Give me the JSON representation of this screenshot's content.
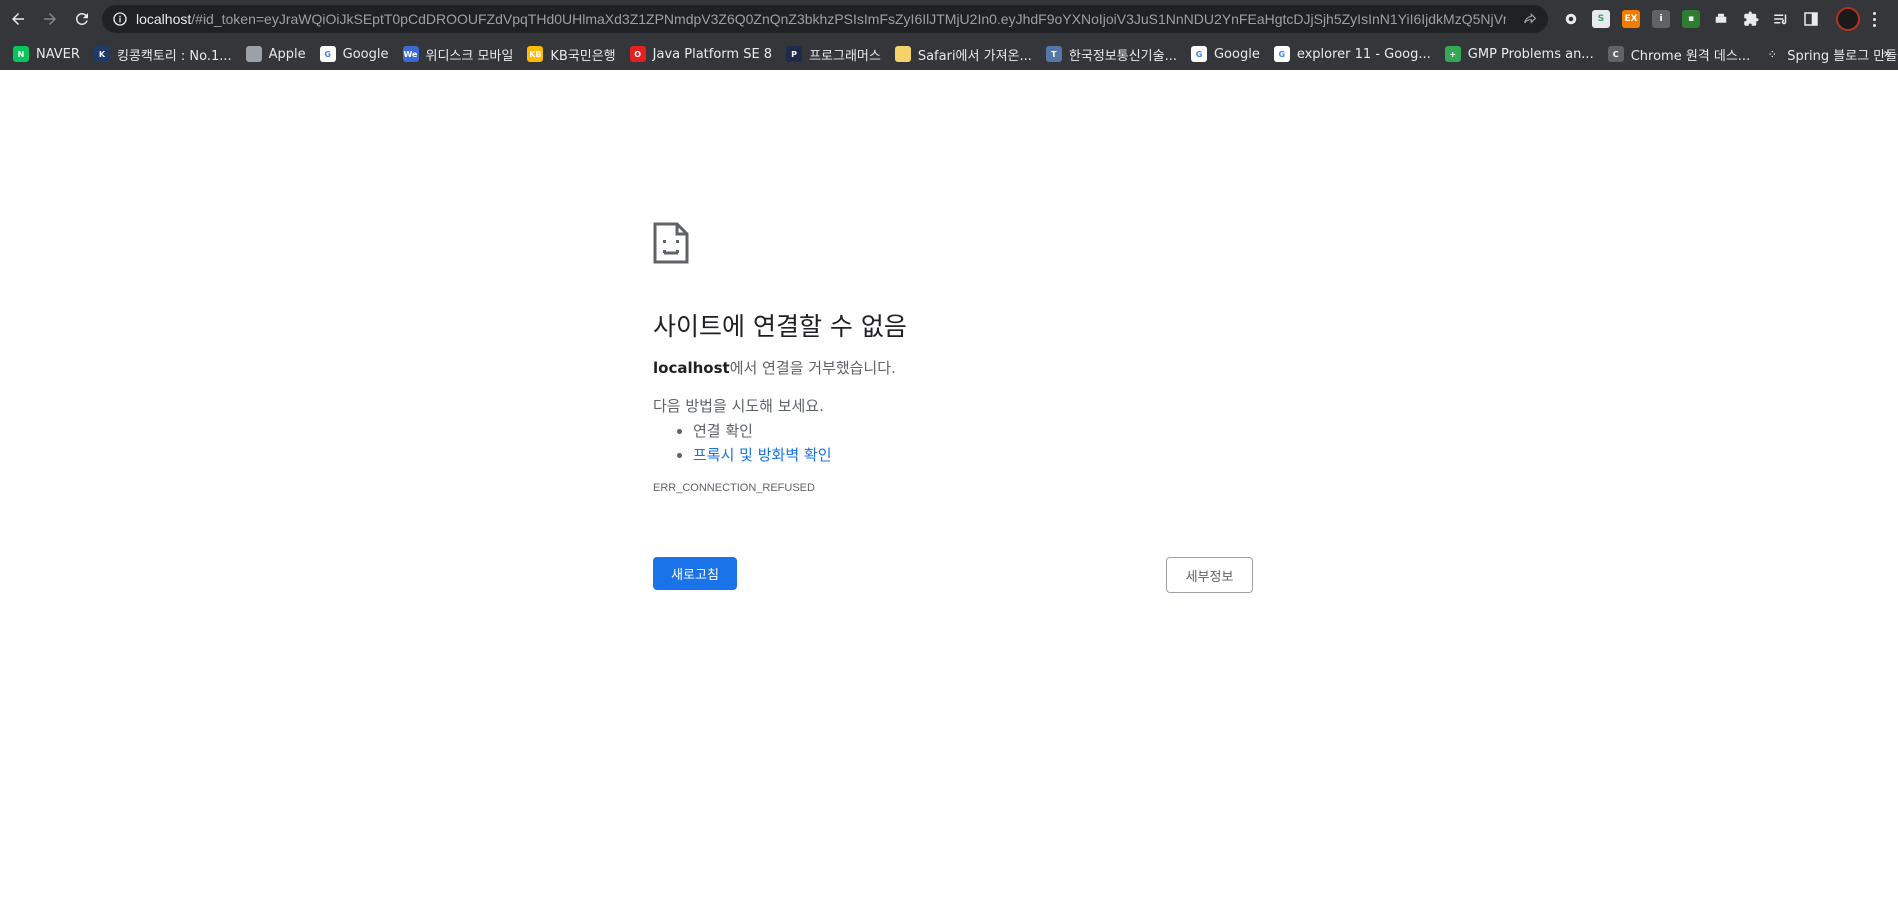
{
  "browser": {
    "url_host": "localhost",
    "url_rest": "/#id_token=eyJraWQiOiJkSEptT0pCdDROOUFZdVpqTHd0UHlmaXd3Z1ZPNmdpV3Z6Q0ZnQnZ3bkhzPSIsImFsZyI6IlJTMjU2In0.eyJhdF9oYXNoIjoiV3JuS1NnNDU2YnFEaHgtcDJjSjh5ZyIsInN1YiI6IjdkMzQ5NjVmL...",
    "extensions": [
      "settings-gear-ext",
      "spreadsheet-ext",
      "ex-ext",
      "info-ext",
      "green-ext",
      "printer-ext",
      "puzzle-extensions",
      "reading-list",
      "side-panel"
    ],
    "colors": {
      "toolbar": "#35363a",
      "omnibox": "#202124"
    }
  },
  "bookmarks": [
    {
      "label": "NAVER",
      "icon": "naver-icon",
      "color": "#03c75a",
      "glyph": "N"
    },
    {
      "label": "킹콩캑토리 : No.1...",
      "icon": "kingkong-icon",
      "color": "#1f3b6b",
      "glyph": "K"
    },
    {
      "label": "Apple",
      "icon": "apple-icon",
      "color": "#9aa0a6",
      "glyph": ""
    },
    {
      "label": "Google",
      "icon": "google-icon",
      "color": "#ffffff",
      "glyph": "G"
    },
    {
      "label": "위디스크 모바일",
      "icon": "wedisk-icon",
      "color": "#3b6ad6",
      "glyph": "We"
    },
    {
      "label": "KB국민은행",
      "icon": "kb-icon",
      "color": "#ffbc00",
      "glyph": "KB"
    },
    {
      "label": "Java Platform SE 8",
      "icon": "oracle-icon",
      "color": "#e52020",
      "glyph": "O"
    },
    {
      "label": "프로그래머스",
      "icon": "programmers-icon",
      "color": "#1e2a4a",
      "glyph": "P"
    },
    {
      "label": "Safari에서 가져온...",
      "icon": "folder-icon",
      "color": "#f6d26b",
      "glyph": ""
    },
    {
      "label": "한국정보통신기술...",
      "icon": "tta-icon",
      "color": "#5577aa",
      "glyph": "T"
    },
    {
      "label": "Google",
      "icon": "google-icon",
      "color": "#ffffff",
      "glyph": "G"
    },
    {
      "label": "explorer 11 - Goog...",
      "icon": "google-icon",
      "color": "#ffffff",
      "glyph": "G"
    },
    {
      "label": "GMP Problems an...",
      "icon": "gmp-icon",
      "color": "#34a853",
      "glyph": "+"
    },
    {
      "label": "Chrome 원격 데스...",
      "icon": "remote-desktop-icon",
      "color": "#5f6368",
      "glyph": "C"
    },
    {
      "label": "Spring 블로그 만들...",
      "icon": "spring-icon",
      "color": "#35363a",
      "glyph": "⁘"
    }
  ],
  "error_page": {
    "title": "사이트에 연결할 수 없음",
    "host": "localhost",
    "desc_suffix": "에서 연결을 거부했습니다.",
    "try_title": "다음 방법을 시도해 보세요.",
    "suggestions": [
      "연결 확인",
      "프록시 및 방화벽 확인"
    ],
    "error_code": "ERR_CONNECTION_REFUSED",
    "reload_label": "새로고침",
    "details_label": "세부정보",
    "accent": "#1a73e8"
  }
}
